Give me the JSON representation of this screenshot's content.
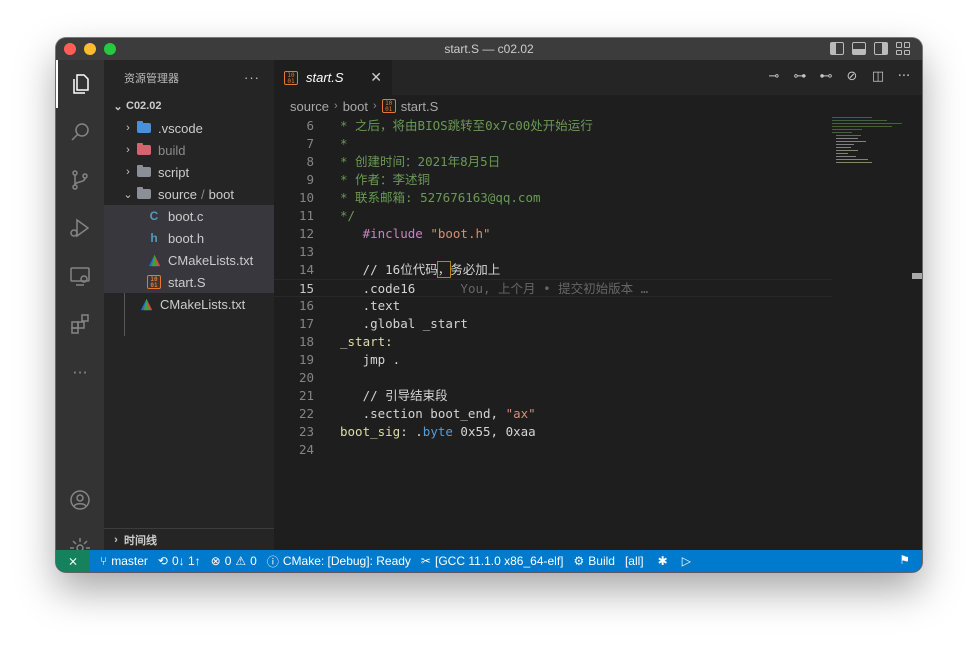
{
  "window": {
    "title": "start.S — c02.02"
  },
  "sidebar": {
    "header": "资源管理器",
    "more": "···",
    "root": "C02.02",
    "items": [
      {
        "label": ".vscode",
        "type": "folder",
        "color": "#4a90d9"
      },
      {
        "label": "build",
        "type": "folder",
        "color": "#d4646e"
      },
      {
        "label": "script",
        "type": "folder",
        "color": "#8a8f98"
      },
      {
        "label": "source",
        "sub": "boot",
        "type": "folder",
        "color": "#8a8f98"
      },
      {
        "label": "boot.c",
        "icon": "C",
        "iconColor": "#519aba"
      },
      {
        "label": "boot.h",
        "icon": "h",
        "iconColor": "#519aba"
      },
      {
        "label": "CMakeLists.txt",
        "icon": "cmake"
      },
      {
        "label": "start.S",
        "icon": "asm"
      },
      {
        "label": "CMakeLists.txt",
        "icon": "cmake"
      }
    ],
    "timeline": "时间线"
  },
  "tab": {
    "label": "start.S",
    "close": "✕"
  },
  "breadcrumb": [
    "source",
    "boot",
    "start.S"
  ],
  "code": {
    "lines": [
      {
        "n": "6",
        "parts": [
          [
            "cmt",
            "* 之后，将由BIOS跳转至0x7c00处开始运行"
          ]
        ]
      },
      {
        "n": "7",
        "parts": [
          [
            "cmt",
            "*"
          ]
        ]
      },
      {
        "n": "8",
        "parts": [
          [
            "cmt",
            "* 创建时间：2021年8月5日"
          ]
        ]
      },
      {
        "n": "9",
        "parts": [
          [
            "cmt",
            "* 作者：李述铜"
          ]
        ]
      },
      {
        "n": "10",
        "parts": [
          [
            "cmt",
            "* 联系邮箱: 527676163@qq.com"
          ]
        ]
      },
      {
        "n": "11",
        "parts": [
          [
            "cmt",
            "*/"
          ]
        ]
      },
      {
        "n": "12",
        "parts": [
          [
            "",
            "   "
          ],
          [
            "kw",
            "#include"
          ],
          [
            "",
            " "
          ],
          [
            "str",
            "\"boot.h\""
          ]
        ]
      },
      {
        "n": "13",
        "parts": []
      },
      {
        "n": "14",
        "parts": [
          [
            "",
            "   // 16位代码"
          ],
          [
            "cursor",
            "，"
          ],
          [
            "",
            "务必加上"
          ]
        ]
      },
      {
        "n": "15",
        "parts": [
          [
            "",
            "   .code16"
          ],
          [
            "ghost",
            "      You, 上个月 • 提交初始版本 …"
          ]
        ]
      },
      {
        "n": "16",
        "parts": [
          [
            "",
            "   .text"
          ]
        ]
      },
      {
        "n": "17",
        "parts": [
          [
            "",
            "   .global _start"
          ]
        ]
      },
      {
        "n": "18",
        "parts": [
          [
            "label",
            "_start:"
          ]
        ]
      },
      {
        "n": "19",
        "parts": [
          [
            "",
            "   jmp ."
          ]
        ]
      },
      {
        "n": "20",
        "parts": []
      },
      {
        "n": "21",
        "parts": [
          [
            "",
            "   // 引导结束段"
          ]
        ]
      },
      {
        "n": "22",
        "parts": [
          [
            "",
            "   .section boot_end, "
          ],
          [
            "str",
            "\"ax\""
          ]
        ]
      },
      {
        "n": "23",
        "parts": [
          [
            "label",
            "boot_sig"
          ],
          [
            "",
            ": ."
          ],
          [
            "blue",
            "byte"
          ],
          [
            "",
            " 0x55, 0xaa"
          ]
        ]
      },
      {
        "n": "24",
        "parts": []
      }
    ],
    "current_line": "15"
  },
  "status": {
    "branch": "master",
    "sync": "0↓ 1↑",
    "errors": "0",
    "warnings": "0",
    "cmake": "CMake: [Debug]: Ready",
    "kit": "[GCC 11.1.0 x86_64-elf]",
    "build": "Build",
    "target": "[all]"
  },
  "colors": {
    "status_bg": "#007acc",
    "remote_bg": "#16825d",
    "comment": "#6a9955"
  }
}
